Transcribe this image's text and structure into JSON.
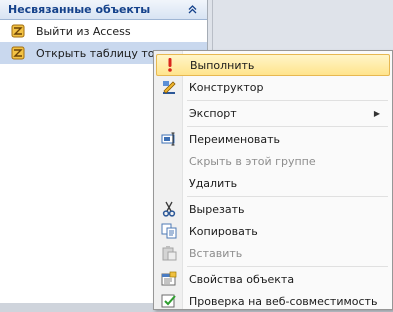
{
  "nav": {
    "header_title": "Несвязанные объекты",
    "items": [
      {
        "label": "Выйти из Access",
        "icon": "macro-icon"
      },
      {
        "label": "Открыть таблицу това",
        "icon": "macro-icon"
      }
    ]
  },
  "context_menu": {
    "items": [
      {
        "key": "run",
        "label": "Выполнить",
        "icon": "exclamation-icon",
        "enabled": true,
        "highlighted": true
      },
      {
        "key": "design",
        "label": "Конструктор",
        "icon": "design-view-icon",
        "enabled": true
      },
      {
        "key": "export",
        "label": "Экспорт",
        "icon": null,
        "enabled": true,
        "submenu": true
      },
      {
        "key": "rename",
        "label": "Переименовать",
        "icon": "rename-icon",
        "enabled": true
      },
      {
        "key": "hide",
        "label": "Скрыть в этой группе",
        "icon": null,
        "enabled": false
      },
      {
        "key": "delete",
        "label": "Удалить",
        "icon": null,
        "enabled": true
      },
      {
        "key": "cut",
        "label": "Вырезать",
        "icon": "scissors-icon",
        "enabled": true
      },
      {
        "key": "copy",
        "label": "Копировать",
        "icon": "copy-icon",
        "enabled": true
      },
      {
        "key": "paste",
        "label": "Вставить",
        "icon": "paste-icon",
        "enabled": false
      },
      {
        "key": "properties",
        "label": "Свойства объекта",
        "icon": "properties-icon",
        "enabled": true
      },
      {
        "key": "webcheck",
        "label": "Проверка на веб-совместимость",
        "icon": "web-check-icon",
        "enabled": true
      }
    ]
  },
  "colors": {
    "header_text": "#15428b",
    "highlight_fill": "#ffe48c",
    "highlight_border": "#e7b851"
  }
}
